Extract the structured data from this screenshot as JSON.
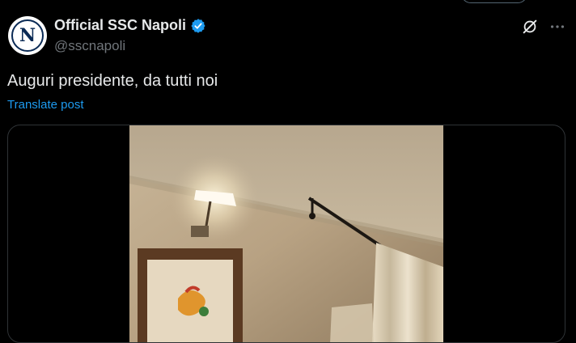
{
  "post": {
    "display_name": "Official SSC Napoli",
    "handle": "@sscnapoli",
    "verified": true,
    "avatar_letter": "N",
    "text": "Auguri presidente, da tutti noi",
    "translate_label": "Translate post"
  },
  "icons": {
    "verified": "verified-badge-icon",
    "grok": "grok-icon",
    "more": "more-options-icon"
  },
  "colors": {
    "background": "#000000",
    "text": "#e7e9ea",
    "secondary_text": "#71767b",
    "link": "#1d9bf0",
    "verified_badge": "#1d9bf0",
    "card_border": "#2f3336"
  }
}
